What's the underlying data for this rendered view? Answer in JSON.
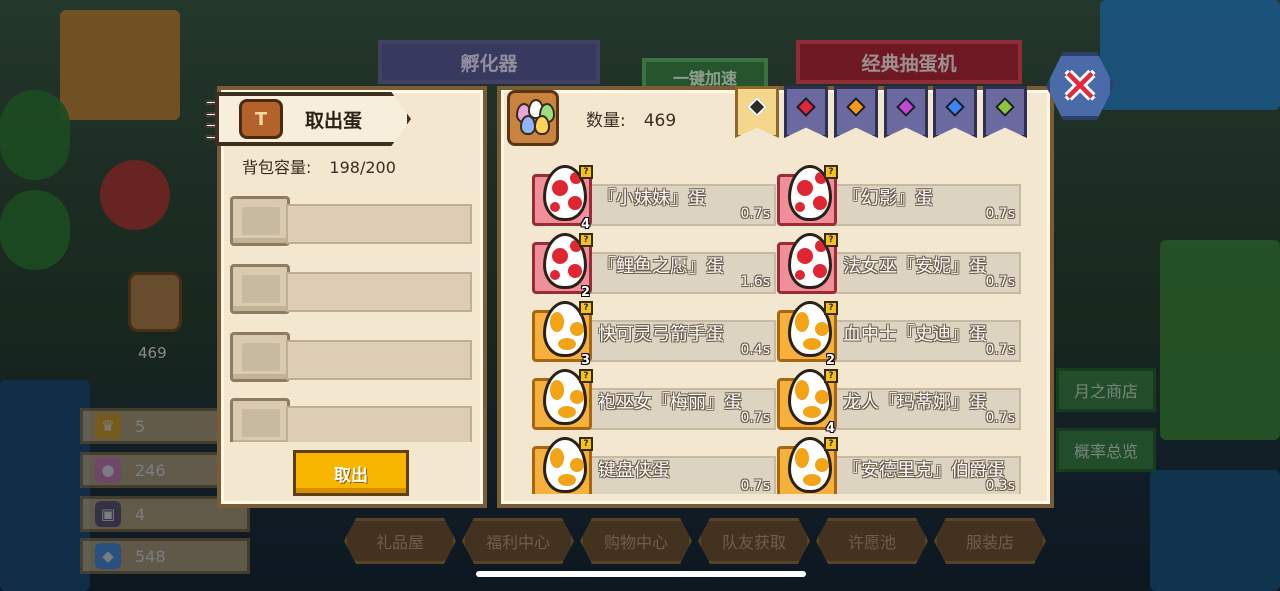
{
  "background": {
    "tabs": [
      {
        "label": "孵化器"
      },
      {
        "label": "一键加速"
      },
      {
        "label": "经典抽蛋机"
      }
    ],
    "side_pile_count": "469",
    "stats": [
      {
        "icon": "crown-icon",
        "value": "5",
        "color": "#f5b52a"
      },
      {
        "icon": "potion-icon",
        "value": "246",
        "color": "#e58acb"
      },
      {
        "icon": "chest-icon",
        "value": "4",
        "color": "#6d5a82"
      },
      {
        "icon": "diamond-icon",
        "value": "548",
        "color": "#4fa3ff"
      }
    ],
    "bottom_nav": [
      "礼品屋",
      "福利中心",
      "购物中心",
      "队友获取",
      "许愿池",
      "服装店"
    ],
    "right_buttons": [
      "月之商店",
      "概率总览"
    ]
  },
  "left_panel": {
    "title": "取出蛋",
    "capacity_label": "背包容量:",
    "capacity_value": "198/200",
    "slots": 4,
    "take_button": "取出"
  },
  "right_panel": {
    "quantity_label": "数量:",
    "quantity_value": "469",
    "filter_tabs": [
      {
        "icon": "diamond-black-icon",
        "color": "#2a2a2a",
        "active": true
      },
      {
        "icon": "diamond-red-icon",
        "color": "#e0283a",
        "active": false
      },
      {
        "icon": "diamond-orange-icon",
        "color": "#f59a1a",
        "active": false
      },
      {
        "icon": "diamond-purple-icon",
        "color": "#c24ad1",
        "active": false
      },
      {
        "icon": "diamond-blue-icon",
        "color": "#3b86f0",
        "active": false
      },
      {
        "icon": "diamond-green-icon",
        "color": "#8cc63f",
        "active": false
      }
    ],
    "eggs": [
      {
        "name": "『小妹妹』蛋",
        "time": "0.7s",
        "count": "4",
        "color": "red"
      },
      {
        "name": "『幻影』蛋",
        "time": "0.7s",
        "count": "",
        "color": "red"
      },
      {
        "name": "『鲤鱼之愿』蛋",
        "time": "1.6s",
        "count": "2",
        "color": "red"
      },
      {
        "name": "法女巫『安妮』蛋",
        "time": "0.7s",
        "count": "",
        "color": "red"
      },
      {
        "name": "快可灵弓箭手蛋",
        "time": "0.4s",
        "count": "3",
        "color": "orange"
      },
      {
        "name": "血中士『史迪』蛋",
        "time": "0.7s",
        "count": "2",
        "color": "orange"
      },
      {
        "name": "袍巫女『梅丽』蛋",
        "time": "0.7s",
        "count": "",
        "color": "orange"
      },
      {
        "name": "龙人『玛蒂娜』蛋",
        "time": "0.7s",
        "count": "4",
        "color": "orange"
      },
      {
        "name": "键盘侠蛋",
        "time": "0.7s",
        "count": "",
        "color": "orange"
      },
      {
        "name": "『安德里克』伯爵蛋",
        "time": "0.3s",
        "count": "",
        "color": "orange"
      }
    ]
  },
  "colors": {
    "panel_bg": "#f3e7cf",
    "panel_border": "#7a5c37",
    "button_yellow": "#f7b500",
    "close_red": "#e6283a"
  }
}
